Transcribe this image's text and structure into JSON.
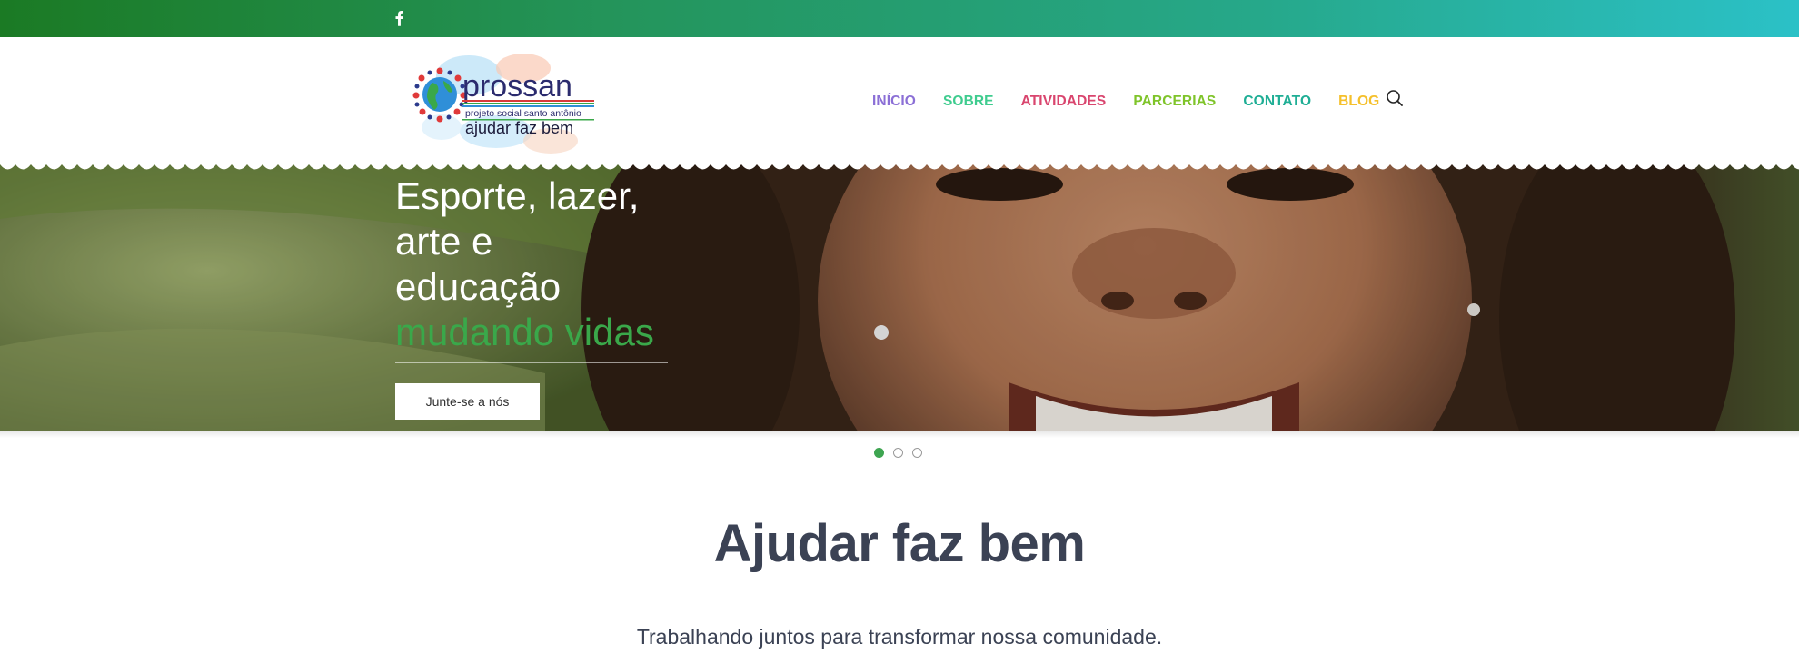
{
  "social": {
    "facebook_icon": "facebook-icon"
  },
  "logo": {
    "name": "prossan",
    "tagline": "projeto social santo antônio",
    "slogan": "ajudar faz bem"
  },
  "nav": {
    "items": [
      {
        "label": "INÍCIO",
        "color": "#8b6fd6"
      },
      {
        "label": "SOBRE",
        "color": "#3fcc8f"
      },
      {
        "label": "ATIVIDADES",
        "color": "#d9456e"
      },
      {
        "label": "PARCERIAS",
        "color": "#7fc42a"
      },
      {
        "label": "CONTATO",
        "color": "#1fae95"
      },
      {
        "label": "BLOG",
        "color": "#f5c02c"
      }
    ],
    "search_icon": "search-icon"
  },
  "hero": {
    "line1": "Esporte, lazer,",
    "line2": "arte e",
    "line3": "educação",
    "accent": "mudando vidas",
    "button": "Junte-se a nós"
  },
  "slider": {
    "count": 3,
    "active": 1
  },
  "section": {
    "title": "Ajudar faz bem",
    "subtitle": "Trabalhando juntos para transformar nossa comunidade."
  },
  "colors": {
    "topbar_start": "#1b7a24",
    "topbar_end": "#2bc1c7",
    "accent_green": "#3aa84a",
    "heading": "#3b4254"
  }
}
